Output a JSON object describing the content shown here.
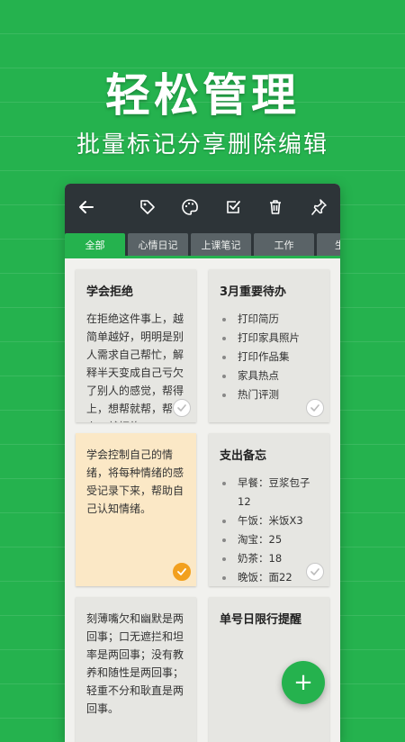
{
  "hero": {
    "title": "轻松管理",
    "subtitle": "批量标记分享删除编辑"
  },
  "toolbar": {
    "icons": [
      "back-arrow-icon",
      "tag-icon",
      "palette-icon",
      "check-square-icon",
      "trash-icon",
      "pin-icon"
    ]
  },
  "tabs": [
    {
      "label": "全部",
      "active": true
    },
    {
      "label": "心情日记",
      "active": false
    },
    {
      "label": "上课笔记",
      "active": false
    },
    {
      "label": "工作",
      "active": false
    },
    {
      "label": "生",
      "active": false
    }
  ],
  "cards": [
    {
      "title": "学会拒绝",
      "body": "在拒绝这件事上，越简单越好，明明是别人需求自己帮忙，解释半天变成自己亏欠了别人的感觉，帮得上，想帮就帮，帮不上，就拒绝",
      "checked": false,
      "color": "#e6e6e2"
    },
    {
      "title": "3月重要待办",
      "items": [
        "打印简历",
        "打印家具照片",
        "打印作品集",
        "家具热点",
        "热门评测"
      ],
      "checked": false,
      "color": "#e6e6e2"
    },
    {
      "title": "",
      "body": "学会控制自己的情绪，将每种情绪的感受记录下来，帮助自己认知情绪。",
      "checked": true,
      "color": "#fbe8c6"
    },
    {
      "title": "支出备忘",
      "items": [
        "早餐：豆浆包子12",
        "午饭：米饭X3",
        "淘宝：25",
        "奶茶：18",
        "晚饭：面22"
      ],
      "checked": false,
      "color": "#e6e6e2"
    },
    {
      "title": "",
      "body": "刻薄嘴欠和幽默是两回事；口无遮拦和坦率是两回事；没有教养和随性是两回事；轻重不分和耿直是两回事。",
      "checked": false,
      "color": "#e6e6e2"
    },
    {
      "title": "单号日限行提醒",
      "checked": false,
      "color": "#e6e6e2"
    }
  ],
  "fab": {
    "label": "+"
  }
}
